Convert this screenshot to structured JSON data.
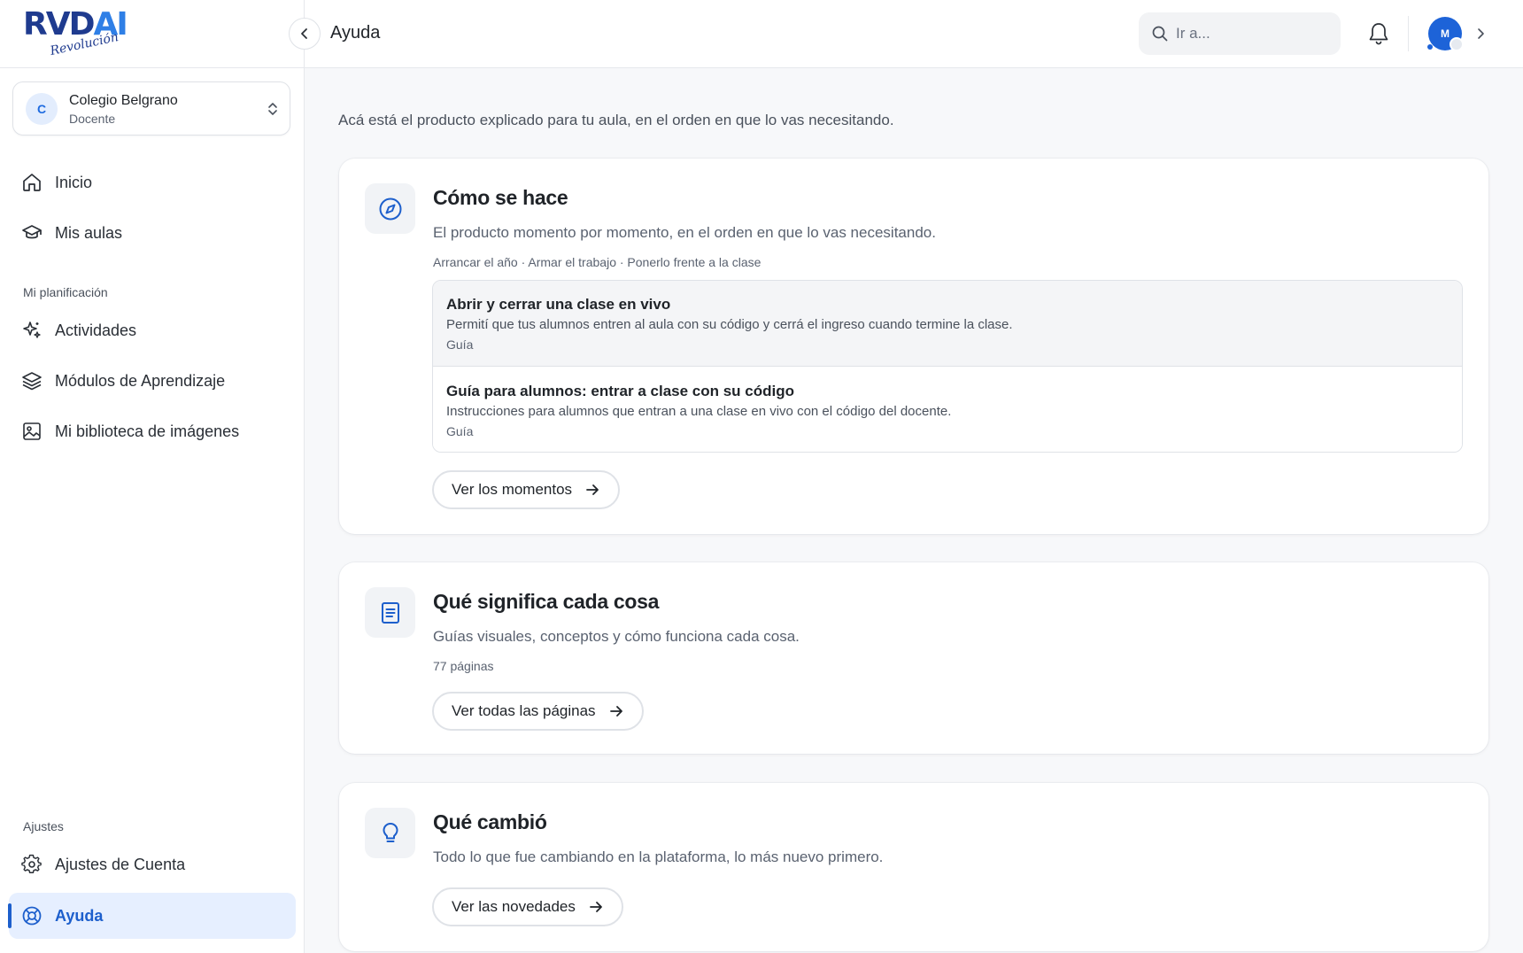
{
  "brand": {
    "logo_main": "RVD",
    "logo_accent": "AI",
    "logo_script": "Revolución"
  },
  "school": {
    "initial": "C",
    "name": "Colegio Belgrano",
    "role": "Docente"
  },
  "sidebar": {
    "items": [
      {
        "label": "Inicio",
        "icon": "home-icon"
      },
      {
        "label": "Mis aulas",
        "icon": "graduation-cap-icon"
      }
    ],
    "planning_section": "Mi planificación",
    "planning_items": [
      {
        "label": "Actividades",
        "icon": "sparkles-icon"
      },
      {
        "label": "Módulos de Aprendizaje",
        "icon": "layers-icon"
      },
      {
        "label": "Mi biblioteca de imágenes",
        "icon": "image-icon"
      }
    ],
    "settings_section": "Ajustes",
    "settings_items": [
      {
        "label": "Ajustes de Cuenta",
        "icon": "gear-icon"
      },
      {
        "label": "Ayuda",
        "icon": "lifebuoy-icon",
        "active": true
      }
    ]
  },
  "topbar": {
    "title": "Ayuda",
    "search_placeholder": "Ir a...",
    "user_initial": "M"
  },
  "main": {
    "intro": "Acá está el producto explicado para tu aula, en el orden en que lo vas necesitando.",
    "cards": [
      {
        "title": "Cómo se hace",
        "subtitle": "El producto momento por momento, en el orden en que lo vas necesitando.",
        "meta": "Arrancar el año · Armar el trabajo · Ponerlo frente a la clase",
        "guides": [
          {
            "title": "Abrir y cerrar una clase en vivo",
            "desc": "Permití que tus alumnos entren al aula con su código y cerrá el ingreso cuando termine la clase.",
            "type": "Guía"
          },
          {
            "title": "Guía para alumnos: entrar a clase con su código",
            "desc": "Instrucciones para alumnos que entran a una clase en vivo con el código del docente.",
            "type": "Guía"
          }
        ],
        "button": "Ver los momentos"
      },
      {
        "title": "Qué significa cada cosa",
        "subtitle": "Guías visuales, conceptos y cómo funciona cada cosa.",
        "meta": "77 páginas",
        "button": "Ver todas las páginas"
      },
      {
        "title": "Qué cambió",
        "subtitle": "Todo lo que fue cambiando en la plataforma, lo más nuevo primero.",
        "button": "Ver las novedades"
      }
    ]
  },
  "colors": {
    "accent": "#1d5fcc",
    "accent_bg": "#e6efff"
  }
}
